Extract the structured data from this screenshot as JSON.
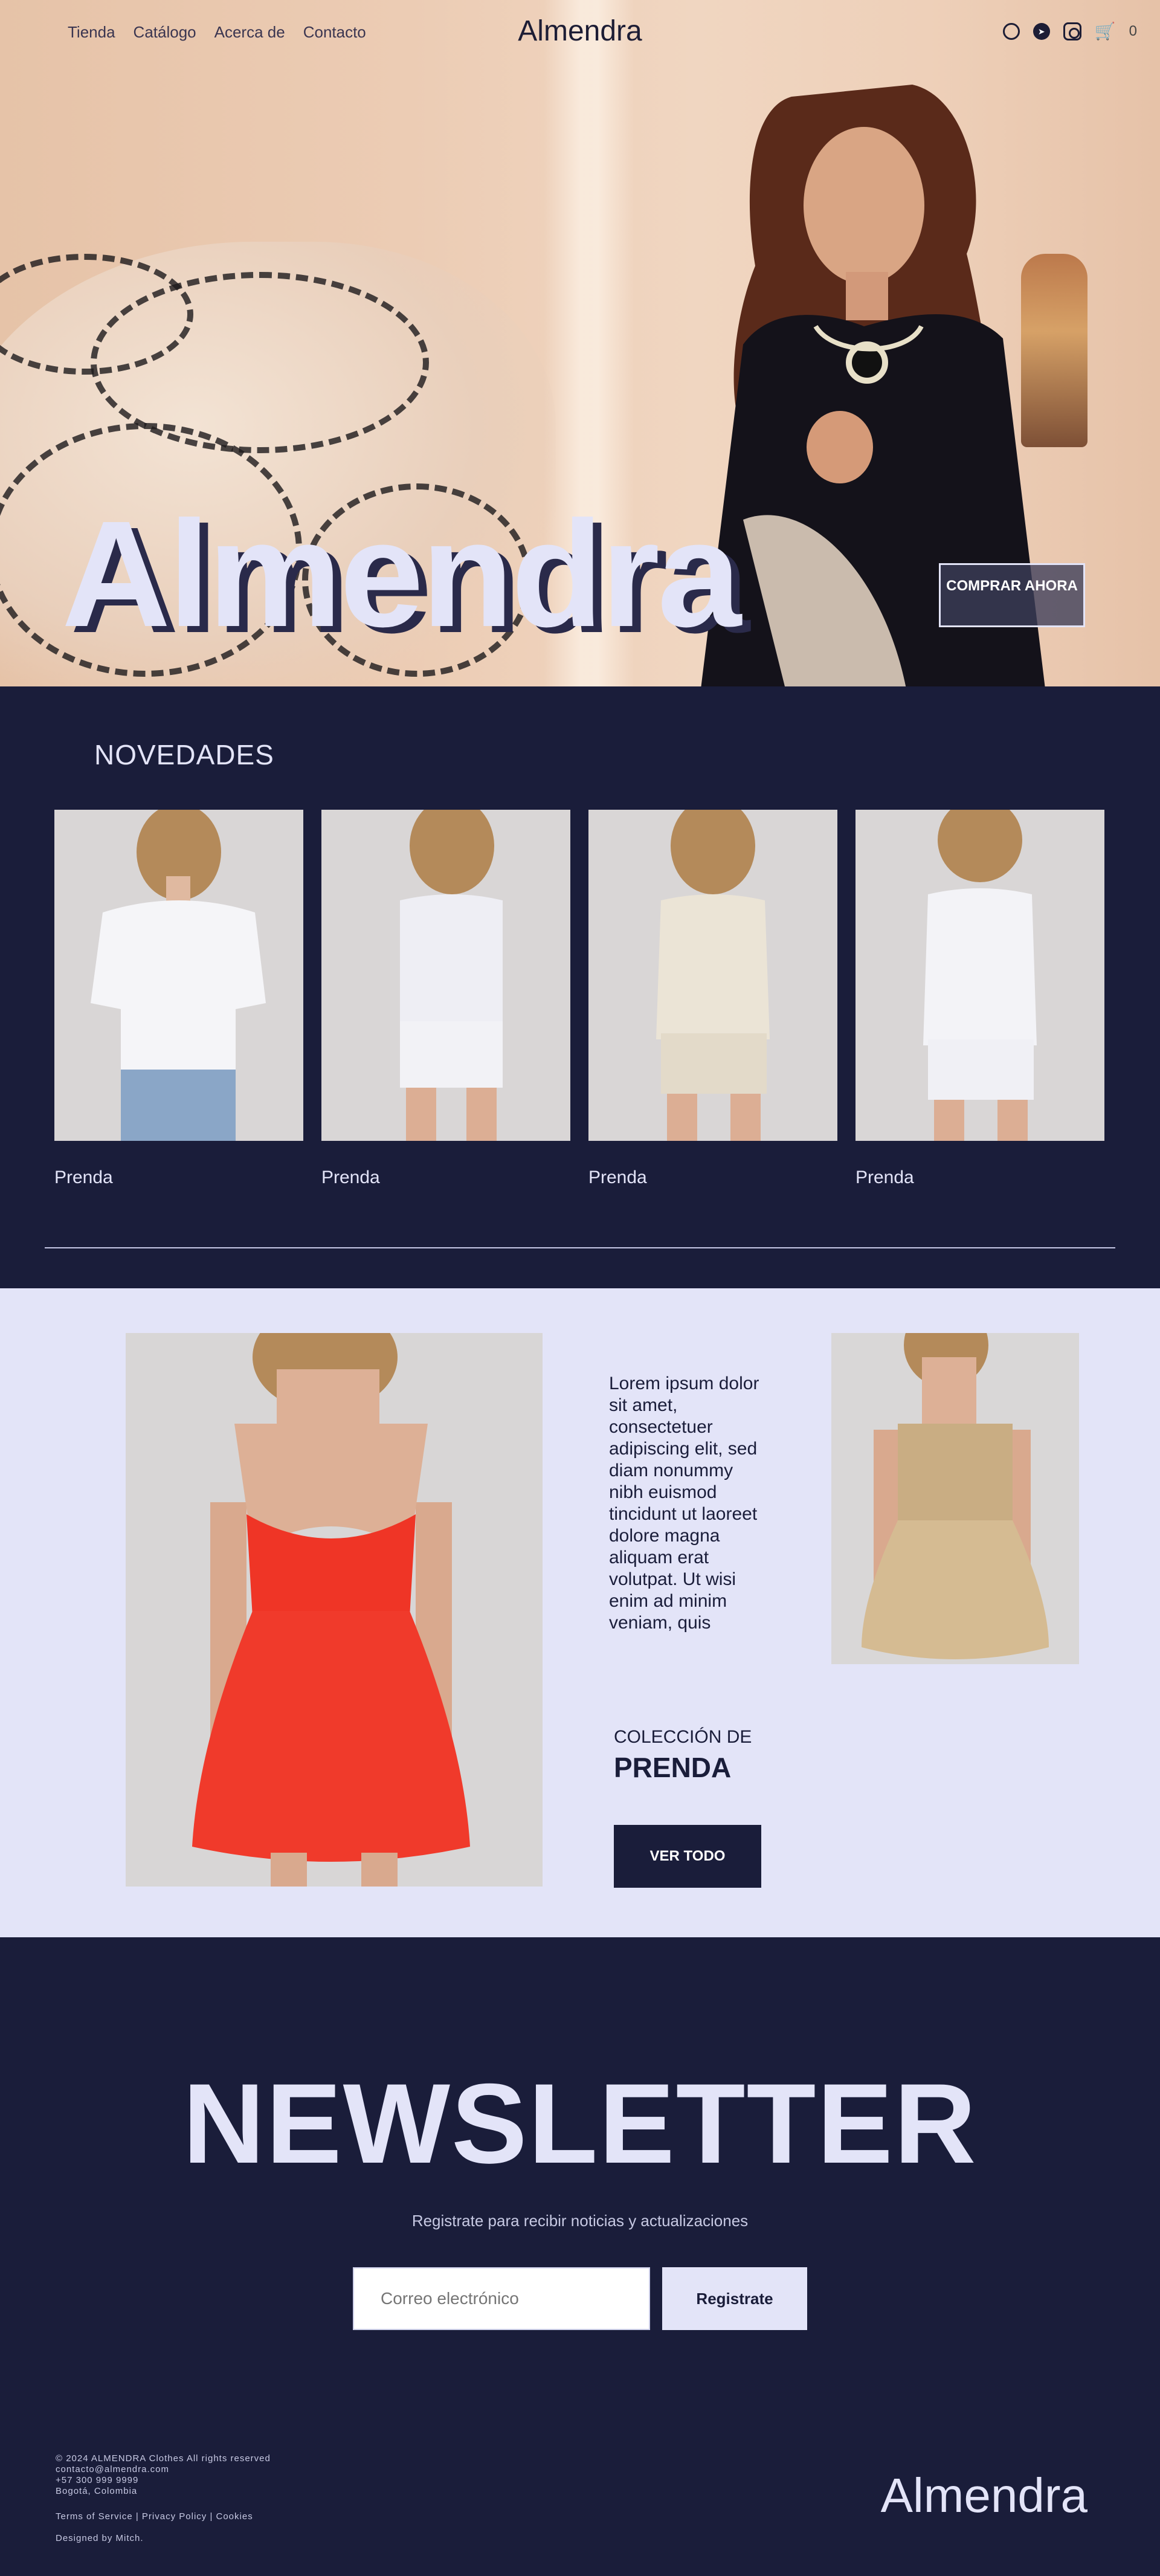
{
  "nav": {
    "links": [
      "Tienda",
      "Catálogo",
      "Acerca de",
      "Contacto"
    ],
    "brand": "Almendra",
    "cart_count": "0",
    "icons": [
      "whatsapp-icon",
      "telegram-icon",
      "instagram-icon",
      "cart-icon"
    ]
  },
  "hero": {
    "title": "Almendra",
    "cta": "COMPRAR AHORA"
  },
  "news": {
    "heading": "NOVEDADES",
    "items": [
      {
        "label": "Prenda"
      },
      {
        "label": "Prenda"
      },
      {
        "label": "Prenda"
      },
      {
        "label": "Prenda"
      }
    ]
  },
  "collection": {
    "text": "Lorem ipsum dolor sit amet, consectetuer adipiscing elit, sed diam nonummy nibh euismod tincidunt ut laoreet dolore magna aliquam erat volutpat. Ut wisi enim ad minim veniam, quis",
    "kicker": "COLECCIÓN DE",
    "name": "PRENDA",
    "button": "VER TODO"
  },
  "newsletter": {
    "title": "NEWSLETTER",
    "subtitle": "Registrate para recibir noticias y actualizaciones",
    "placeholder": "Correo electrónico",
    "button": "Registrate"
  },
  "footer": {
    "copyright": "© 2024 ALMENDRA Clothes All rights reserved",
    "email": "contacto@almendra.com",
    "phone": "+57 300 999 9999",
    "city": "Bogotá, Colombia",
    "links": "Terms of Service | Privacy Policy | Cookies",
    "designed": "Designed by Mitch.",
    "brand": "Almendra"
  },
  "colors": {
    "navy": "#1a1d3a",
    "lavender": "#e3e4f8"
  }
}
